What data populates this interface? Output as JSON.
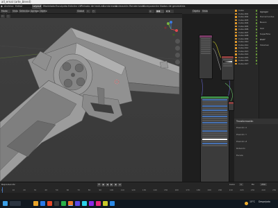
{
  "window": {
    "title": "all_ernal (arte_blend)"
  },
  "menubar": {
    "items": [
      "Archivo",
      "Editar",
      "Renderizado",
      "Ventana",
      "Ayuda"
    ],
    "workspaces": [
      "Layout",
      "Modelado",
      "Esculpido",
      "Edición UV",
      "Pintado de textura",
      "Sombreado",
      "Animación",
      "Renderizado",
      "Composición",
      "Nodos de geometría",
      "Scripting"
    ],
    "active_workspace": "Layout"
  },
  "viewport_header": {
    "mode": "Modo objeto",
    "view": "Vista",
    "select": "Seleccionar",
    "add": "Agregar",
    "object": "Objeto",
    "global": "Global"
  },
  "node_header": {
    "label": "Objeto",
    "view": "Vista"
  },
  "right_panel": {
    "tabs": [
      "Agregar",
      "Herramientas"
    ],
    "rows": [
      "Nuevo",
      "Slot",
      "Superficie",
      "BSDF",
      "Volumen"
    ]
  },
  "outliner": {
    "rows": [
      "Cube",
      "Cube.001",
      "Cube.002",
      "Cube.003",
      "Cube.004",
      "Cube.005",
      "Cube.006",
      "Cube.007",
      "Cube.008",
      "Cube.009",
      "Cube.010",
      "Cube.011",
      "Cube.012",
      "Cube.013",
      "Cube.014",
      "Cube.015",
      "Cube.016",
      "Cube.017"
    ]
  },
  "props": {
    "label": "Transformación",
    "rows": [
      "Posición X",
      "Posición Y",
      "Posición Z",
      "Rotación",
      "Escala"
    ]
  },
  "timeline": {
    "label": "Reproducción",
    "ticks": [
      "0",
      "10",
      "20",
      "30",
      "40",
      "50",
      "60",
      "70",
      "80",
      "90",
      "100",
      "110",
      "120",
      "130",
      "140",
      "150",
      "160",
      "170",
      "180",
      "190",
      "200",
      "210",
      "220",
      "230",
      "240",
      "250"
    ],
    "start_label": "Inicio",
    "start": "1",
    "end_label": "Fin",
    "end": "250"
  },
  "taskbar": {
    "temperature": "15°C",
    "weather": "Despejado",
    "time": "8:07 p.m.",
    "lang": "ESP"
  },
  "colors": {
    "accent": "#4772b3",
    "gizmo_x": "#e0484e",
    "gizmo_y": "#79b53e",
    "gizmo_z": "#3d7be0"
  }
}
